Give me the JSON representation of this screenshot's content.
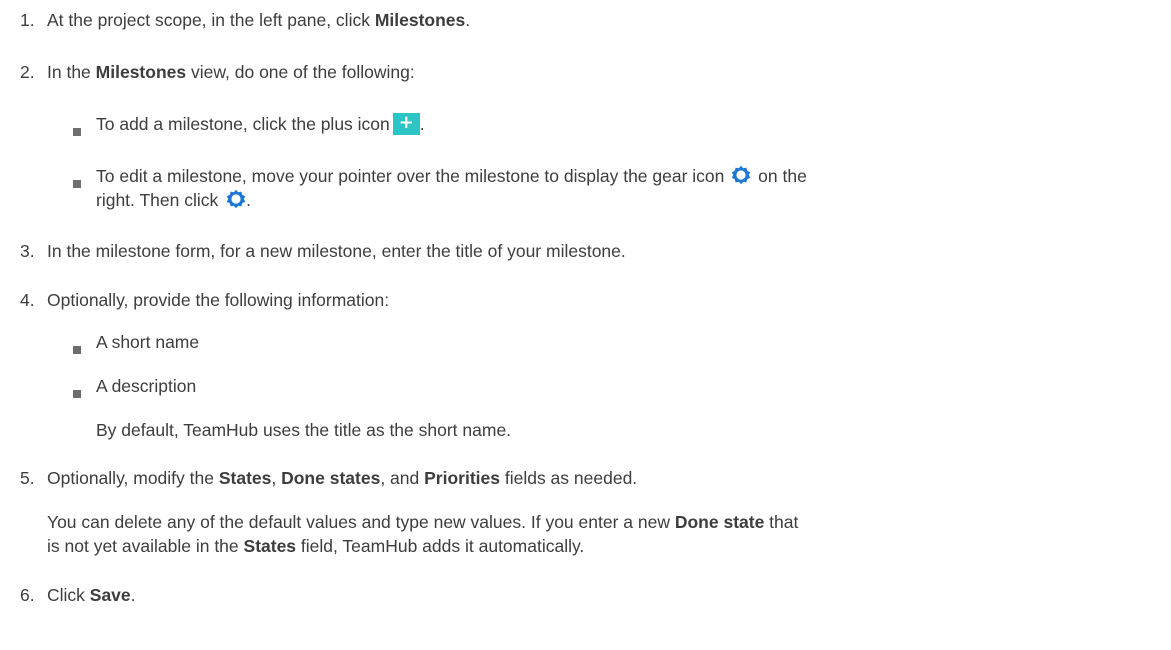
{
  "steps": {
    "s1": {
      "num": "1.",
      "pre": "At the project scope, in the left pane, click ",
      "bold": "Milestones",
      "post": "."
    },
    "s2": {
      "num": "2.",
      "pre": "In the ",
      "bold": "Milestones",
      "post": " view, do one of the following:",
      "b1": {
        "pre": "To add a milestone, click the plus icon",
        "icon_symbol": "+",
        "post": "."
      },
      "b2": {
        "pre": "To edit a milestone, move your pointer over the milestone to display the gear icon",
        "post": "on the",
        "line2_pre": "right. Then click",
        "line2_post": "."
      }
    },
    "s3": {
      "num": "3.",
      "text": "In the milestone form, for a new milestone, enter the title of your milestone."
    },
    "s4": {
      "num": "4.",
      "text": "Optionally, provide the following information:",
      "b1": "A short name",
      "b2": "A description",
      "note": "By default, TeamHub uses the title as the short name."
    },
    "s5": {
      "num": "5.",
      "pre": "Optionally, modify the ",
      "bold1": "States",
      "sep1": ", ",
      "bold2": "Done states",
      "sep2": ", and ",
      "bold3": "Priorities",
      "post": " fields as needed.",
      "para_l1_pre": "You can delete any of the default values and type new values. If you enter a new ",
      "para_l1_bold": "Done state",
      "para_l1_post": " that",
      "para_l2_pre": "is not yet available in the ",
      "para_l2_bold": "States",
      "para_l2_post": " field, TeamHub adds it automatically."
    },
    "s6": {
      "num": "6.",
      "pre": "Click ",
      "bold": "Save",
      "post": "."
    }
  },
  "colors": {
    "text": "#3d3d3d",
    "plus_icon_bg": "#2cc4c4",
    "gear_icon": "#1e78d2",
    "bullet": "#6e6e6e"
  },
  "icons": [
    "plus-icon",
    "gear-icon"
  ]
}
